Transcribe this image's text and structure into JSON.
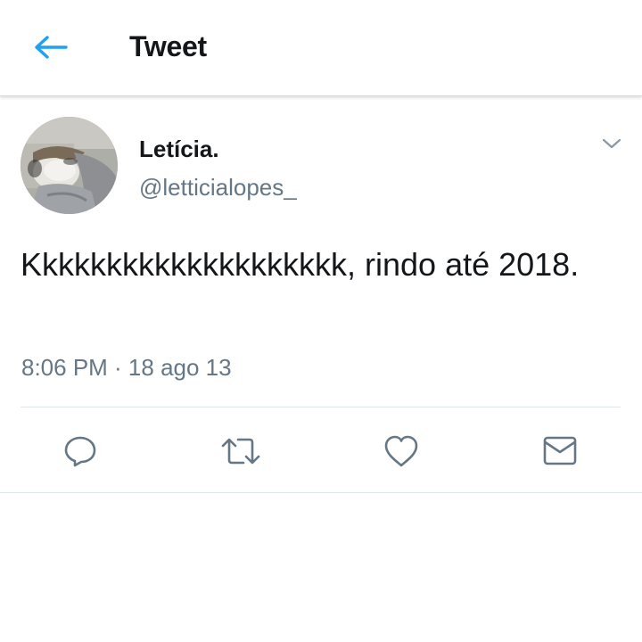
{
  "header": {
    "title": "Tweet",
    "back_icon": "arrow-left-icon",
    "accent_color": "#1da1f2"
  },
  "tweet": {
    "display_name": "Letícia.",
    "handle": "@letticialopes_",
    "text": "Kkkkkkkkkkkkkkkkkkkk, rindo até 2018.",
    "timestamp": "8:06 PM · 18 ago 13",
    "menu_icon": "chevron-down-icon"
  },
  "actions": [
    {
      "name": "reply",
      "icon": "reply-icon"
    },
    {
      "name": "retweet",
      "icon": "retweet-icon"
    },
    {
      "name": "like",
      "icon": "heart-icon"
    },
    {
      "name": "share",
      "icon": "envelope-icon"
    }
  ],
  "colors": {
    "text_primary": "#14171a",
    "text_secondary": "#657786",
    "icon_gray": "#657786",
    "divider": "#dfe7ea"
  }
}
